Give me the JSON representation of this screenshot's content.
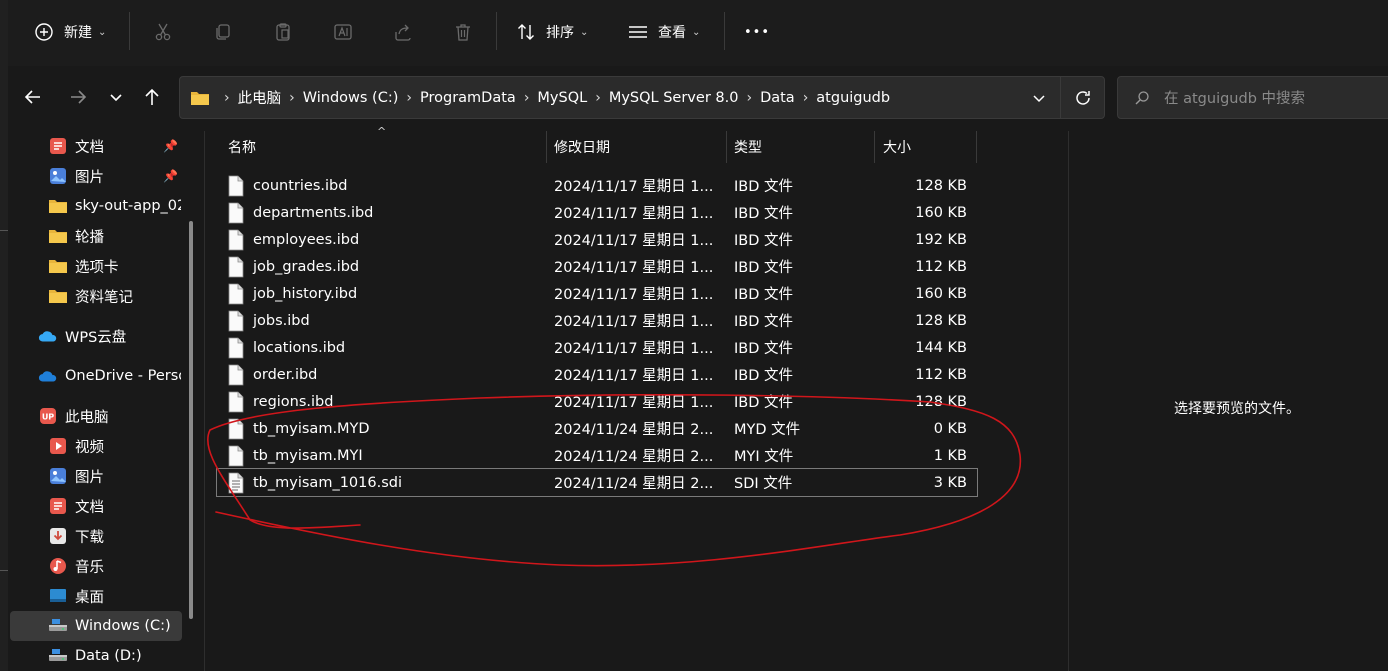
{
  "toolbar": {
    "new_label": "新建",
    "sort_label": "排序",
    "view_label": "查看",
    "more_label": "•••"
  },
  "address": {
    "crumbs": [
      "此电脑",
      "Windows (C:)",
      "ProgramData",
      "MySQL",
      "MySQL Server 8.0",
      "Data",
      "atguigudb"
    ]
  },
  "search": {
    "placeholder": "在 atguigudb 中搜索"
  },
  "sidebar": {
    "items": [
      {
        "label": "文档",
        "icon": "documents-icon",
        "pinned": true
      },
      {
        "label": "图片",
        "icon": "pictures-icon",
        "pinned": true
      },
      {
        "label": "sky-out-app_02",
        "icon": "folder-icon"
      },
      {
        "label": "轮播",
        "icon": "folder-icon"
      },
      {
        "label": "选项卡",
        "icon": "folder-icon"
      },
      {
        "label": "资料笔记",
        "icon": "folder-icon"
      },
      {
        "label": "WPS云盘",
        "icon": "wps-cloud-icon"
      },
      {
        "label": "OneDrive - Personal",
        "icon": "onedrive-icon"
      },
      {
        "label": "此电脑",
        "icon": "this-pc-icon"
      },
      {
        "label": "视频",
        "icon": "videos-icon"
      },
      {
        "label": "图片",
        "icon": "pictures-icon"
      },
      {
        "label": "文档",
        "icon": "documents-icon"
      },
      {
        "label": "下载",
        "icon": "downloads-icon"
      },
      {
        "label": "音乐",
        "icon": "music-icon"
      },
      {
        "label": "桌面",
        "icon": "desktop-icon"
      },
      {
        "label": "Windows (C:)",
        "icon": "drive-icon",
        "selected": true
      },
      {
        "label": "Data (D:)",
        "icon": "drive-icon"
      }
    ]
  },
  "columns": {
    "name": "名称",
    "date": "修改日期",
    "type": "类型",
    "size": "大小"
  },
  "files": [
    {
      "name": "countries.ibd",
      "date": "2024/11/17 星期日 1...",
      "type": "IBD 文件",
      "size": "128 KB"
    },
    {
      "name": "departments.ibd",
      "date": "2024/11/17 星期日 1...",
      "type": "IBD 文件",
      "size": "160 KB"
    },
    {
      "name": "employees.ibd",
      "date": "2024/11/17 星期日 1...",
      "type": "IBD 文件",
      "size": "192 KB"
    },
    {
      "name": "job_grades.ibd",
      "date": "2024/11/17 星期日 1...",
      "type": "IBD 文件",
      "size": "112 KB"
    },
    {
      "name": "job_history.ibd",
      "date": "2024/11/17 星期日 1...",
      "type": "IBD 文件",
      "size": "160 KB"
    },
    {
      "name": "jobs.ibd",
      "date": "2024/11/17 星期日 1...",
      "type": "IBD 文件",
      "size": "128 KB"
    },
    {
      "name": "locations.ibd",
      "date": "2024/11/17 星期日 1...",
      "type": "IBD 文件",
      "size": "144 KB"
    },
    {
      "name": "order.ibd",
      "date": "2024/11/17 星期日 1...",
      "type": "IBD 文件",
      "size": "112 KB"
    },
    {
      "name": "regions.ibd",
      "date": "2024/11/17 星期日 1...",
      "type": "IBD 文件",
      "size": "128 KB"
    },
    {
      "name": "tb_myisam.MYD",
      "date": "2024/11/24 星期日 2...",
      "type": "MYD 文件",
      "size": "0 KB"
    },
    {
      "name": "tb_myisam.MYI",
      "date": "2024/11/24 星期日 2...",
      "type": "MYI 文件",
      "size": "1 KB"
    },
    {
      "name": "tb_myisam_1016.sdi",
      "date": "2024/11/24 星期日 2...",
      "type": "SDI 文件",
      "size": "3 KB"
    }
  ],
  "preview": {
    "message": "选择要预览的文件。"
  },
  "colors": {
    "background": "#191919",
    "annotation": "#d0161b",
    "accent": "#4aa3ff"
  }
}
